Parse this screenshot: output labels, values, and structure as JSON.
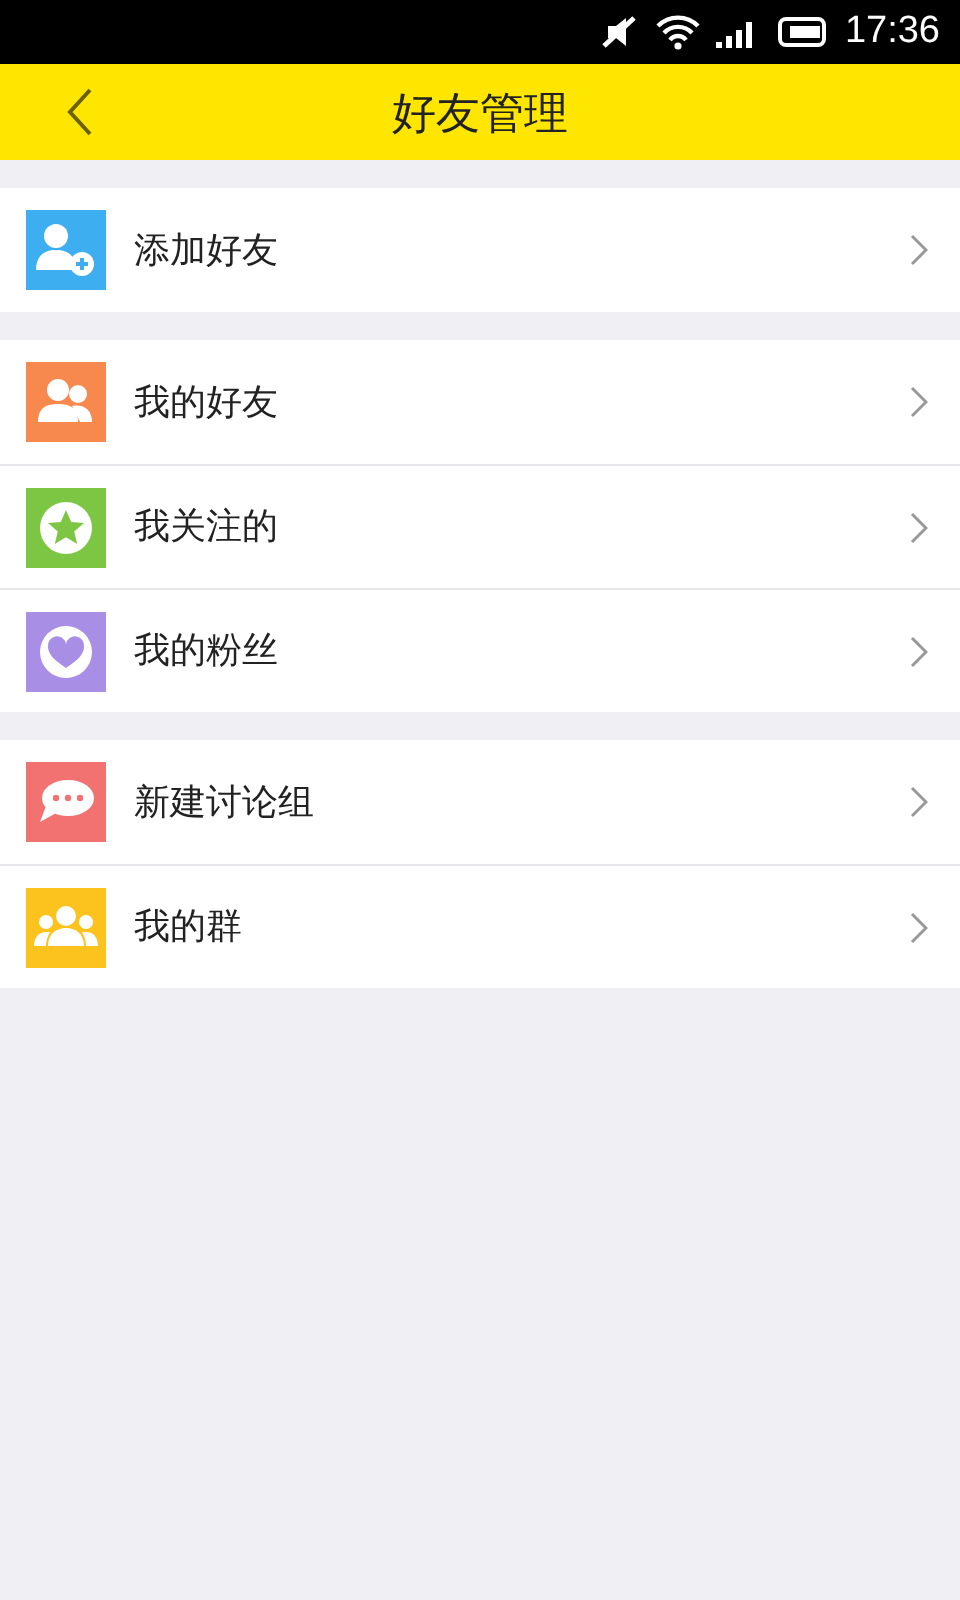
{
  "status_bar": {
    "time": "17:36"
  },
  "header": {
    "title": "好友管理"
  },
  "groups": [
    {
      "items": [
        {
          "label": "添加好友",
          "kind": "adduser",
          "color": "#3daef0"
        }
      ]
    },
    {
      "items": [
        {
          "label": "我的好友",
          "kind": "friends",
          "color": "#f7894f"
        },
        {
          "label": "我关注的",
          "kind": "star",
          "color": "#7cc644"
        },
        {
          "label": "我的粉丝",
          "kind": "heart",
          "color": "#a98ee6"
        }
      ]
    },
    {
      "items": [
        {
          "label": "新建讨论组",
          "kind": "chat",
          "color": "#f27272"
        },
        {
          "label": "我的群",
          "kind": "group",
          "color": "#fcc21d"
        }
      ]
    }
  ]
}
